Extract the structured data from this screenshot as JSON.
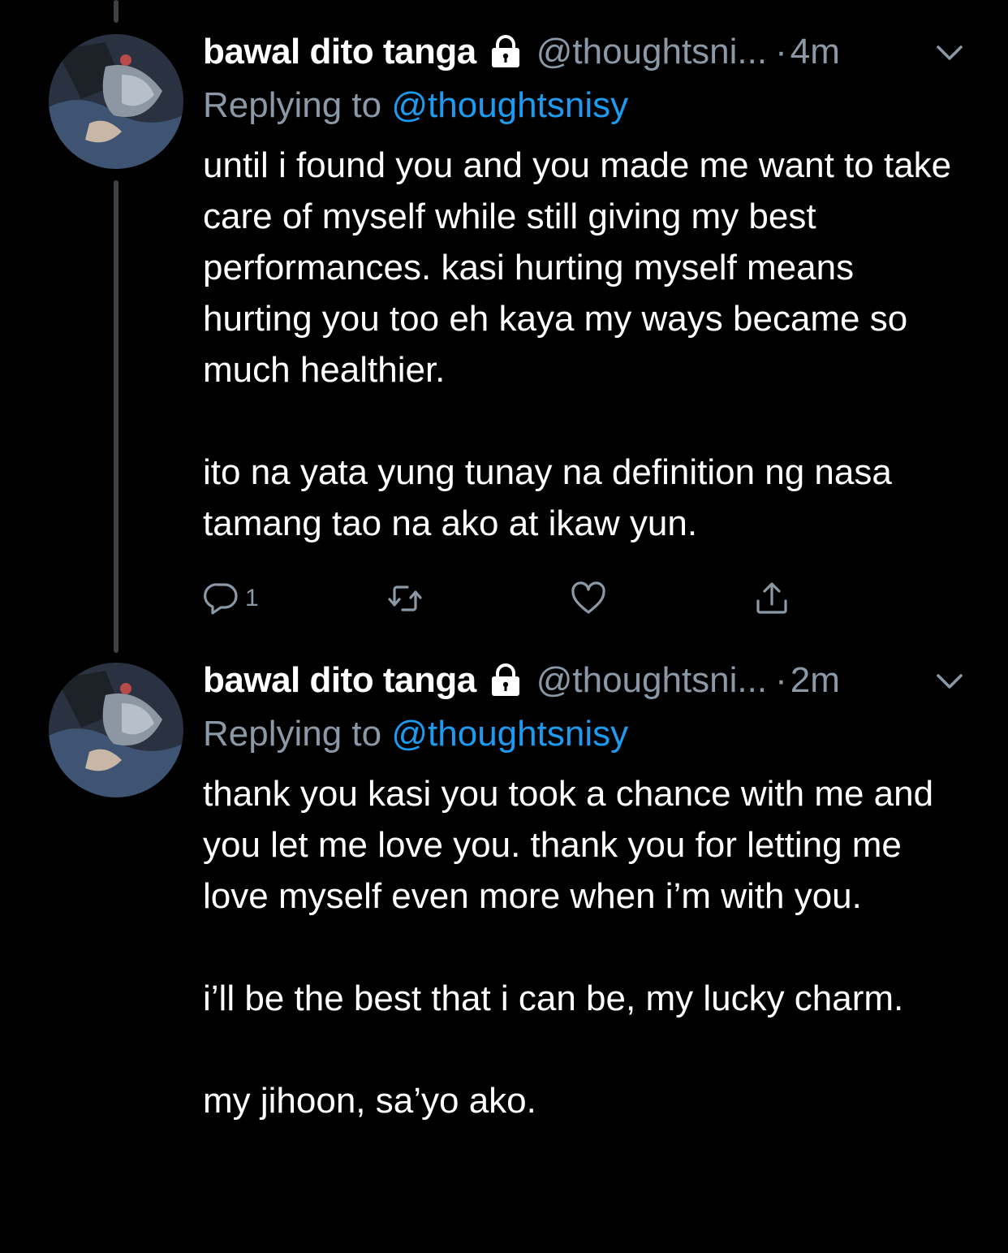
{
  "tweets": [
    {
      "display_name": "bawal dito tanga",
      "handle": "@thoughtsni...",
      "separator": "·",
      "time": "4m",
      "replying_prefix": "Replying to",
      "replying_to": "@thoughtsnisy",
      "text": "until i found you and you made me want to take care of myself while still giving my best performances. kasi hurting myself means hurting you too eh kaya my ways became so much healthier.\n\nito na yata yung tunay na definition ng nasa tamang tao na ako at ikaw yun.",
      "reply_count": "1",
      "icons": [
        "lock-icon",
        "chevron-down-icon",
        "reply-icon",
        "retweet-icon",
        "like-icon",
        "share-icon"
      ]
    },
    {
      "display_name": "bawal dito tanga",
      "handle": "@thoughtsni...",
      "separator": "·",
      "time": "2m",
      "replying_prefix": "Replying to",
      "replying_to": "@thoughtsnisy",
      "text": "thank you kasi you took a chance with me and you let me love you. thank you for letting me love myself even more when i’m with you.\n\ni’ll be the best that i can be, my lucky charm.\n\nmy jihoon, sa’yo ako.",
      "icons": [
        "lock-icon",
        "chevron-down-icon"
      ]
    }
  ],
  "colors": {
    "background": "#000000",
    "text": "#ffffff",
    "secondary": "#8b98a5",
    "mention": "#1d9bf0",
    "thread_line": "#3d4247"
  }
}
